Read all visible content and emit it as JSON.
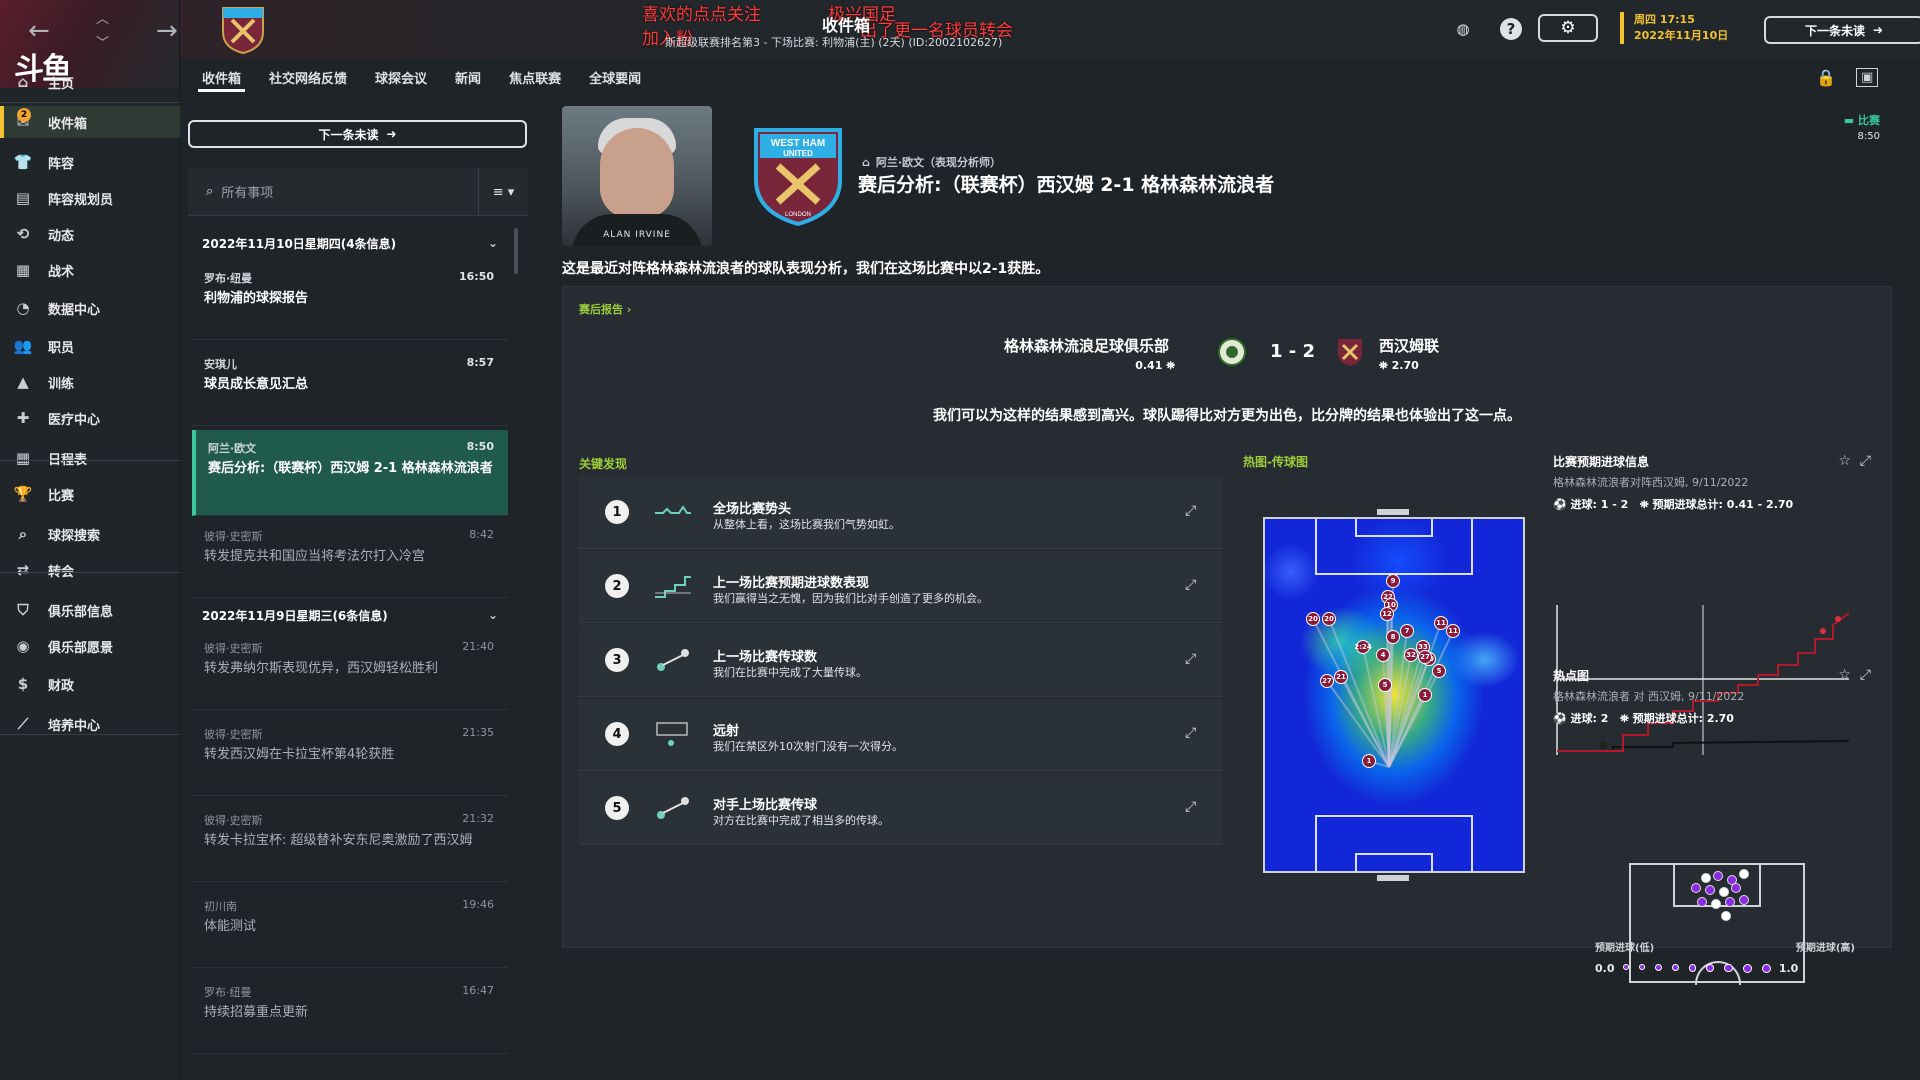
{
  "nav": {
    "back": "←",
    "forward": "→",
    "logo": "斗鱼",
    "items": [
      {
        "label": "主页",
        "icon": "home-icon",
        "glyph": "⌂"
      },
      {
        "label": "收件箱",
        "icon": "inbox-icon",
        "glyph": "✉",
        "badge": "2"
      },
      {
        "label": "阵容",
        "icon": "shirt-icon",
        "glyph": "👕"
      },
      {
        "label": "阵容规划员",
        "icon": "clipboard-icon",
        "glyph": "▤"
      },
      {
        "label": "动态",
        "icon": "refresh-icon",
        "glyph": "⟲"
      },
      {
        "label": "战术",
        "icon": "tactics-icon",
        "glyph": "▦"
      },
      {
        "label": "数据中心",
        "icon": "chart-circle-icon",
        "glyph": "◔"
      },
      {
        "label": "职员",
        "icon": "staff-icon",
        "glyph": "👥"
      },
      {
        "label": "训练",
        "icon": "cone-icon",
        "glyph": "▲"
      },
      {
        "label": "医疗中心",
        "icon": "medical-icon",
        "glyph": "✚"
      },
      {
        "label": "日程表",
        "icon": "calendar-icon",
        "glyph": "▦"
      },
      {
        "label": "比赛",
        "icon": "trophy-icon",
        "glyph": "🏆"
      },
      {
        "label": "球探搜索",
        "icon": "search-icon",
        "glyph": "⌕"
      },
      {
        "label": "转会",
        "icon": "transfer-icon",
        "glyph": "⇄"
      },
      {
        "label": "俱乐部信息",
        "icon": "shield-icon",
        "glyph": "⛉"
      },
      {
        "label": "俱乐部愿景",
        "icon": "vision-icon",
        "glyph": "◉"
      },
      {
        "label": "财政",
        "icon": "money-icon",
        "glyph": "$"
      },
      {
        "label": "培养中心",
        "icon": "development-icon",
        "glyph": "⟋"
      }
    ]
  },
  "header": {
    "overlay_1": "喜欢的点点关注",
    "overlay_2": "加入粉",
    "overlay_3": "极兴国足",
    "overlay_4": "出了更一名球员转会",
    "title": "收件箱",
    "subtitle": "斯超级联赛排名第3 - 下场比赛: 利物浦(主) (2天) (ID:2002102627)",
    "date_line1": "周四 17:15",
    "date_line2": "2022年11月10日",
    "next_unread": "下一条未读"
  },
  "tabs": [
    {
      "label": "收件箱",
      "active": true
    },
    {
      "label": "社交网络反馈",
      "active": false
    },
    {
      "label": "球探会议",
      "active": false
    },
    {
      "label": "新闻",
      "active": false
    },
    {
      "label": "焦点联赛",
      "active": false
    },
    {
      "label": "全球要闻",
      "active": false
    }
  ],
  "inbox": {
    "next_unread": "下一条未读",
    "search_placeholder": "所有事项",
    "day1": "2022年11月10日星期四(4条信息)",
    "day2": "2022年11月9日星期三(6条信息)",
    "messages": [
      {
        "from": "罗布·纽曼",
        "subject": "利物浦的球探报告",
        "time": "16:50",
        "read": false
      },
      {
        "from": "安琪儿",
        "subject": "球员成长意见汇总",
        "time": "8:57",
        "read": false
      },
      {
        "from": "阿兰·欧文",
        "subject": "赛后分析:（联赛杯）西汉姆 2-1 格林森林流浪者",
        "time": "8:50",
        "read": false,
        "selected": true
      },
      {
        "from": "彼得·史密斯",
        "subject": "转发提克共和国应当将考法尔打入冷宫",
        "time": "8:42",
        "read": true
      },
      {
        "from": "彼得·史密斯",
        "subject": "转发弗纳尔斯表现优异，西汉姆轻松胜利",
        "time": "21:40",
        "read": true
      },
      {
        "from": "彼得·史密斯",
        "subject": "转发西汉姆在卡拉宝杯第4轮获胜",
        "time": "21:35",
        "read": true
      },
      {
        "from": "彼得·史密斯",
        "subject": "转发卡拉宝杯: 超级替补安东尼奥激励了西汉姆",
        "time": "21:32",
        "read": true
      },
      {
        "from": "初川南",
        "subject": "体能测试",
        "time": "19:46",
        "read": true
      },
      {
        "from": "罗布·纽曼",
        "subject": "持续招募重点更新",
        "time": "16:47",
        "read": true
      }
    ]
  },
  "detail": {
    "avatar_name": "ALAN IRVINE",
    "sender": "阿兰·欧文（表现分析师）",
    "title": "赛后分析:（联赛杯）西汉姆 2-1 格林森林流浪者",
    "tag": "比赛",
    "tag_time": "8:50",
    "intro": "这是最近对阵格林森林流浪者的球队表现分析，我们在这场比赛中以2-1获胜。",
    "report_link": "赛后报告 ›",
    "home_team": "格林森林流浪足球俱乐部",
    "home_xg": "0.41",
    "score": "1 - 2",
    "away_team": "西汉姆联",
    "away_xg": "2.70",
    "result_text": "我们可以为这样的结果感到高兴。球队踢得比对方更为出色，比分牌的结果也体验出了这一点。",
    "key_findings_title": "关键发现",
    "heatmap_title": "热图-传球图",
    "findings": [
      {
        "num": "1",
        "title": "全场比赛势头",
        "sub": "从整体上看，这场比赛我们气势如虹。"
      },
      {
        "num": "2",
        "title": "上一场比赛预期进球数表现",
        "sub": "我们赢得当之无愧，因为我们比对手创造了更多的机会。"
      },
      {
        "num": "3",
        "title": "上一场比赛传球数",
        "sub": "我们在比赛中完成了大量传球。"
      },
      {
        "num": "4",
        "title": "远射",
        "sub": "我们在禁区外10次射门没有一次得分。"
      },
      {
        "num": "5",
        "title": "对手上场比赛传球",
        "sub": "对方在比赛中完成了相当多的传球。"
      }
    ],
    "players_on_map": [
      "9",
      "22",
      "10",
      "12",
      "20",
      "20",
      "11",
      "33",
      "7",
      "8",
      "11",
      "2:24",
      "4",
      "32",
      "10",
      "5",
      "27",
      "27",
      "21",
      "5",
      "1",
      "1"
    ],
    "xg_panel": {
      "title": "比赛预期进球信息",
      "sub": "格林森林流浪者对阵西汉姆, 9/11/2022",
      "goals": "进球: 1 - 2",
      "xg_total": "预期进球总计: 0.41 - 2.70"
    },
    "heat_panel": {
      "title": "热点图",
      "sub": "格林森林流浪者 对 西汉姆, 9/11/2022",
      "goals": "进球: 2",
      "xg_total": "预期进球总计: 2.70",
      "legend_low": "预期进球(低)",
      "legend_high": "预期进球(高)",
      "scale_min": "0.0",
      "scale_max": "1.0"
    }
  },
  "colors": {
    "accent": "#f2c230",
    "green": "#39c79c",
    "link": "#9ccc3a",
    "west_ham_claret": "#7a263a",
    "west_ham_blue": "#2dafe5"
  }
}
